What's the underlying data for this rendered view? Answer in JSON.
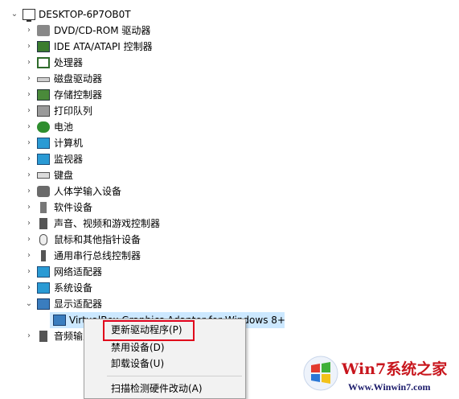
{
  "tree": {
    "root": {
      "label": "DESKTOP-6P7OB0T",
      "icon": "computer-icon",
      "expanded": true
    },
    "categories": [
      {
        "label": "DVD/CD-ROM 驱动器",
        "icon": "dvd-drive-icon"
      },
      {
        "label": "IDE ATA/ATAPI 控制器",
        "icon": "ide-controller-icon"
      },
      {
        "label": "处理器",
        "icon": "processor-icon"
      },
      {
        "label": "磁盘驱动器",
        "icon": "disk-drive-icon"
      },
      {
        "label": "存储控制器",
        "icon": "storage-controller-icon"
      },
      {
        "label": "打印队列",
        "icon": "printer-icon"
      },
      {
        "label": "电池",
        "icon": "battery-icon"
      },
      {
        "label": "计算机",
        "icon": "computer-icon"
      },
      {
        "label": "监视器",
        "icon": "monitor-icon"
      },
      {
        "label": "键盘",
        "icon": "keyboard-icon"
      },
      {
        "label": "人体学输入设备",
        "icon": "hid-icon"
      },
      {
        "label": "软件设备",
        "icon": "software-device-icon"
      },
      {
        "label": "声音、视频和游戏控制器",
        "icon": "audio-icon"
      },
      {
        "label": "鼠标和其他指针设备",
        "icon": "mouse-icon"
      },
      {
        "label": "通用串行总线控制器",
        "icon": "usb-icon"
      },
      {
        "label": "网络适配器",
        "icon": "network-adapter-icon"
      },
      {
        "label": "系统设备",
        "icon": "system-device-icon"
      },
      {
        "label": "显示适配器",
        "icon": "display-adapter-icon",
        "expanded": true
      }
    ],
    "child": {
      "label": "VirtualBox Graphics Adapter for Windows 8+",
      "icon": "display-adapter-icon",
      "selected": true
    },
    "after": {
      "label": "音频输入和输出",
      "icon": "audio-icon"
    }
  },
  "context_menu": {
    "items": [
      {
        "label": "更新驱动程序(P)",
        "highlighted": true
      },
      {
        "label": "禁用设备(D)"
      },
      {
        "label": "卸载设备(U)"
      },
      {
        "label": "扫描检测硬件改动(A)"
      }
    ]
  },
  "watermark": {
    "title": "Win7系统之家",
    "url": "Www.Winwin7.com"
  },
  "colors": {
    "selection": "#cce8ff",
    "highlight_border": "#e0001b",
    "watermark_red": "#c8161d"
  }
}
